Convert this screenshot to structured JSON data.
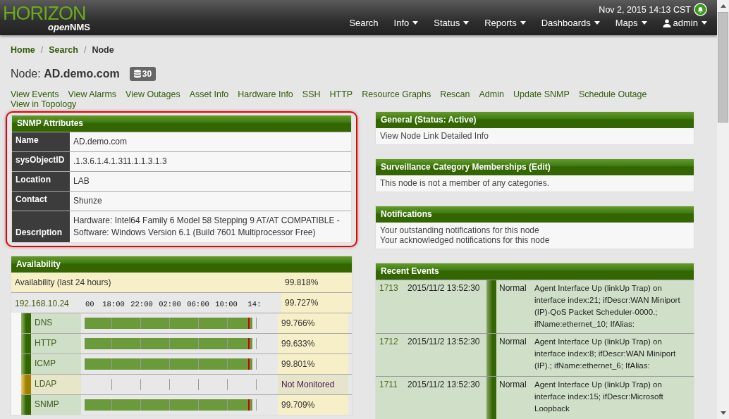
{
  "header": {
    "logo_main": "HORIZON",
    "logo_sub_open": "open",
    "logo_sub_nms": "NMS",
    "datetime": "Nov 2, 2015 14:13 CST",
    "nav": [
      {
        "label": "Search",
        "dropdown": false
      },
      {
        "label": "Info",
        "dropdown": true
      },
      {
        "label": "Status",
        "dropdown": true
      },
      {
        "label": "Reports",
        "dropdown": true
      },
      {
        "label": "Dashboards",
        "dropdown": true
      },
      {
        "label": "Maps",
        "dropdown": true
      },
      {
        "label": "admin",
        "dropdown": true,
        "kind": "user"
      }
    ]
  },
  "breadcrumb_separator": "/",
  "breadcrumb": [
    {
      "label": "Home",
      "link": true
    },
    {
      "label": "Search",
      "link": true
    },
    {
      "label": "Node",
      "link": false
    }
  ],
  "node": {
    "prefix": "Node: ",
    "name": "AD.demo.com",
    "badge": "30"
  },
  "links": [
    "View Events",
    "View Alarms",
    "View Outages",
    "Asset Info",
    "Hardware Info",
    "SSH",
    "HTTP",
    "Resource Graphs",
    "Rescan",
    "Admin",
    "Update SNMP",
    "Schedule Outage",
    "View in Topology"
  ],
  "snmp": {
    "title": "SNMP Attributes",
    "rows": [
      {
        "label": "Name",
        "value": "AD.demo.com"
      },
      {
        "label": "sysObjectID",
        "value": ".1.3.6.1.4.1.311.1.1.3.1.3"
      },
      {
        "label": "Location",
        "value": "LAB"
      },
      {
        "label": "Contact",
        "value": "Shunze"
      },
      {
        "label": "Description",
        "value": "Hardware: Intel64 Family 6 Model 58 Stepping 9 AT/AT COMPATIBLE - Software: Windows Version 6.1 (Build 7601 Multiprocessor Free)"
      }
    ]
  },
  "availability": {
    "title": "Availability",
    "overall_label": "Availability (last 24 hours)",
    "overall_value": "99.818%",
    "interface": "192.168.10.24",
    "interface_value": "99.727%",
    "ticks": [
      "00",
      "18:00",
      "22:00",
      "02:00",
      "06:00",
      "10:00",
      "14:"
    ],
    "services": [
      {
        "name": "DNS",
        "monitored": true,
        "value": "99.766%"
      },
      {
        "name": "HTTP",
        "monitored": true,
        "value": "99.633%"
      },
      {
        "name": "ICMP",
        "monitored": true,
        "value": "99.801%"
      },
      {
        "name": "LDAP",
        "monitored": false,
        "value": "Not Monitored"
      },
      {
        "name": "SNMP",
        "monitored": true,
        "value": "99.709%"
      }
    ]
  },
  "general": {
    "title": "General (Status: Active)",
    "link": "View Node Link Detailed Info"
  },
  "categories": {
    "title": "Surveillance Category Memberships (Edit)",
    "text": "This node is not a member of any categories."
  },
  "notifications": {
    "title": "Notifications",
    "links": [
      "Your outstanding notifications for this node",
      "Your acknowledged notifications for this node"
    ]
  },
  "events": {
    "title": "Recent Events",
    "rows": [
      {
        "id": "1713",
        "time": "2015/11/2 13:52:30",
        "severity": "Normal",
        "text": "Agent Interface Up (linkUp Trap) on interface index:21; ifDescr:WAN Miniport (IP)-QoS Packet Scheduler-0000.; ifName:ethernet_10; IfAlias:"
      },
      {
        "id": "1712",
        "time": "2015/11/2 13:52:30",
        "severity": "Normal",
        "text": "Agent Interface Up (linkUp Trap) on interface index:8; ifDescr:WAN Miniport (IP).; ifName:ethernet_6; IfAlias:"
      },
      {
        "id": "1711",
        "time": "2015/11/2 13:52:30",
        "severity": "Normal",
        "text": "Agent Interface Up (linkUp Trap) on interface index:15; ifDescr:Microsoft Loopback"
      }
    ]
  }
}
